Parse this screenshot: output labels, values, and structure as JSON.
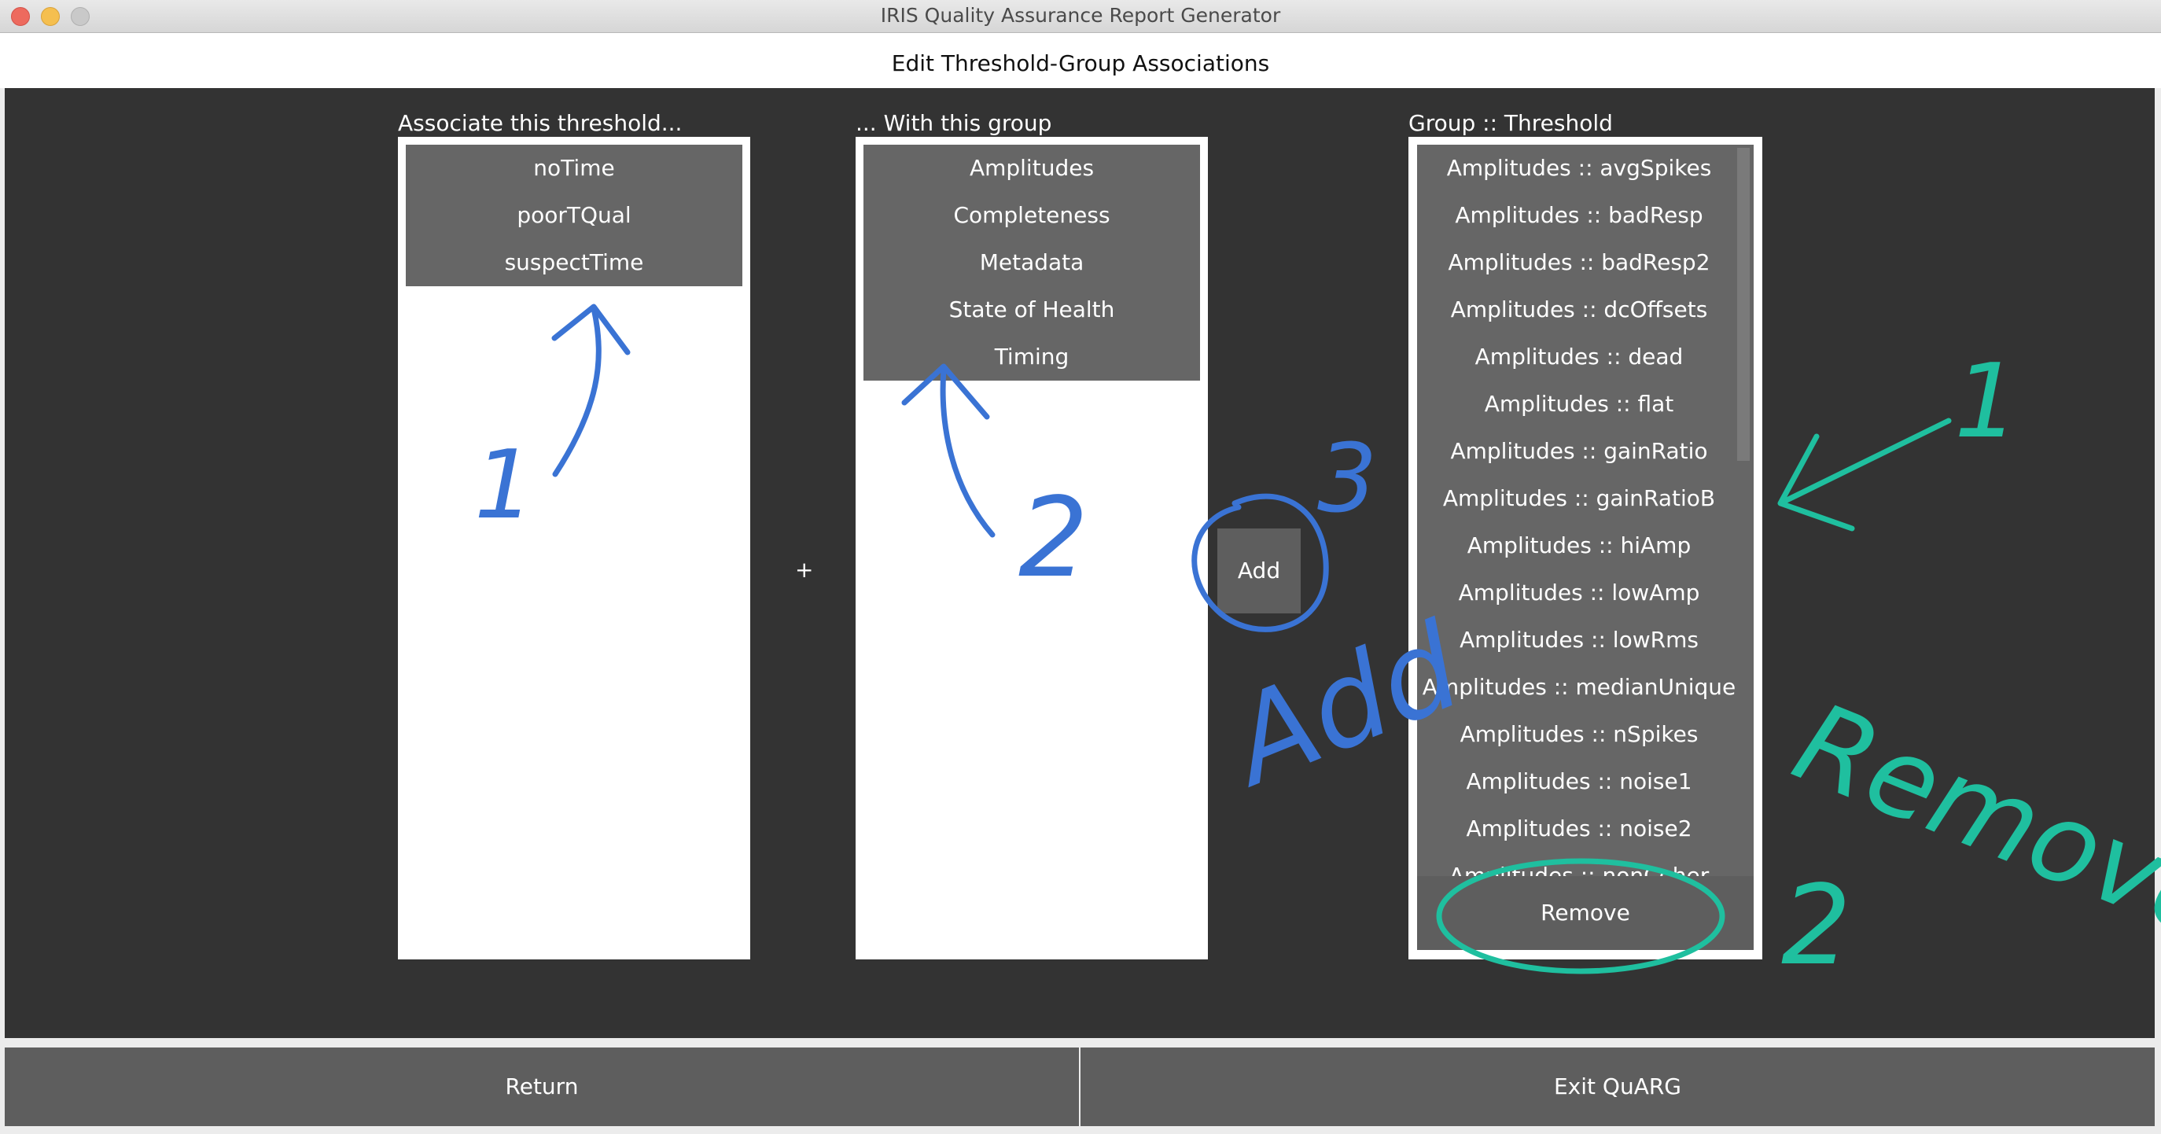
{
  "window": {
    "title": "IRIS Quality Assurance Report Generator"
  },
  "page": {
    "title": "Edit Threshold-Group Associations"
  },
  "threshold_column": {
    "label": "Associate this threshold...",
    "items": [
      "noTime",
      "poorTQual",
      "suspectTime"
    ]
  },
  "plus_sign": "+",
  "group_column": {
    "label": "... With this group",
    "items": [
      "Amplitudes",
      "Completeness",
      "Metadata",
      "State of Health",
      "Timing"
    ]
  },
  "add_button": {
    "label": "Add"
  },
  "associations_column": {
    "label": "Group :: Threshold",
    "items": [
      "Amplitudes :: avgSpikes",
      "Amplitudes :: badResp",
      "Amplitudes :: badResp2",
      "Amplitudes :: dcOffsets",
      "Amplitudes :: dead",
      "Amplitudes :: flat",
      "Amplitudes :: gainRatio",
      "Amplitudes :: gainRatioB",
      "Amplitudes :: hiAmp",
      "Amplitudes :: lowAmp",
      "Amplitudes :: lowRms",
      "Amplitudes :: medianUnique",
      "Amplitudes :: nSpikes",
      "Amplitudes :: noise1",
      "Amplitudes :: noise2",
      "Amplitudes :: nonCoher"
    ]
  },
  "remove_button": {
    "label": "Remove"
  },
  "footer": {
    "return_label": "Return",
    "exit_label": "Exit QuARG"
  },
  "annotations": {
    "color_blue": "#3a73d4",
    "color_teal": "#1fbf9f",
    "blue_step_1": "1",
    "blue_step_2": "2",
    "blue_step_3": "3",
    "blue_word": "Add",
    "teal_step_1": "1",
    "teal_step_2": "2",
    "teal_word": "Remove"
  }
}
